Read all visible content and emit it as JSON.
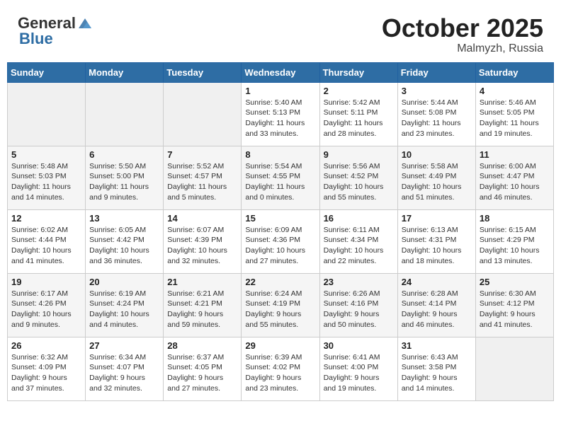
{
  "header": {
    "logo_line1": "General",
    "logo_line2": "Blue",
    "month": "October 2025",
    "location": "Malmyzh, Russia"
  },
  "weekdays": [
    "Sunday",
    "Monday",
    "Tuesday",
    "Wednesday",
    "Thursday",
    "Friday",
    "Saturday"
  ],
  "rows": [
    {
      "bg": "white",
      "cells": [
        {
          "day": "",
          "info": "",
          "empty": true
        },
        {
          "day": "",
          "info": "",
          "empty": true
        },
        {
          "day": "",
          "info": "",
          "empty": true
        },
        {
          "day": "1",
          "info": "Sunrise: 5:40 AM\nSunset: 5:13 PM\nDaylight: 11 hours\nand 33 minutes.",
          "empty": false
        },
        {
          "day": "2",
          "info": "Sunrise: 5:42 AM\nSunset: 5:11 PM\nDaylight: 11 hours\nand 28 minutes.",
          "empty": false
        },
        {
          "day": "3",
          "info": "Sunrise: 5:44 AM\nSunset: 5:08 PM\nDaylight: 11 hours\nand 23 minutes.",
          "empty": false
        },
        {
          "day": "4",
          "info": "Sunrise: 5:46 AM\nSunset: 5:05 PM\nDaylight: 11 hours\nand 19 minutes.",
          "empty": false
        }
      ]
    },
    {
      "bg": "alt",
      "cells": [
        {
          "day": "5",
          "info": "Sunrise: 5:48 AM\nSunset: 5:03 PM\nDaylight: 11 hours\nand 14 minutes.",
          "empty": false
        },
        {
          "day": "6",
          "info": "Sunrise: 5:50 AM\nSunset: 5:00 PM\nDaylight: 11 hours\nand 9 minutes.",
          "empty": false
        },
        {
          "day": "7",
          "info": "Sunrise: 5:52 AM\nSunset: 4:57 PM\nDaylight: 11 hours\nand 5 minutes.",
          "empty": false
        },
        {
          "day": "8",
          "info": "Sunrise: 5:54 AM\nSunset: 4:55 PM\nDaylight: 11 hours\nand 0 minutes.",
          "empty": false
        },
        {
          "day": "9",
          "info": "Sunrise: 5:56 AM\nSunset: 4:52 PM\nDaylight: 10 hours\nand 55 minutes.",
          "empty": false
        },
        {
          "day": "10",
          "info": "Sunrise: 5:58 AM\nSunset: 4:49 PM\nDaylight: 10 hours\nand 51 minutes.",
          "empty": false
        },
        {
          "day": "11",
          "info": "Sunrise: 6:00 AM\nSunset: 4:47 PM\nDaylight: 10 hours\nand 46 minutes.",
          "empty": false
        }
      ]
    },
    {
      "bg": "white",
      "cells": [
        {
          "day": "12",
          "info": "Sunrise: 6:02 AM\nSunset: 4:44 PM\nDaylight: 10 hours\nand 41 minutes.",
          "empty": false
        },
        {
          "day": "13",
          "info": "Sunrise: 6:05 AM\nSunset: 4:42 PM\nDaylight: 10 hours\nand 36 minutes.",
          "empty": false
        },
        {
          "day": "14",
          "info": "Sunrise: 6:07 AM\nSunset: 4:39 PM\nDaylight: 10 hours\nand 32 minutes.",
          "empty": false
        },
        {
          "day": "15",
          "info": "Sunrise: 6:09 AM\nSunset: 4:36 PM\nDaylight: 10 hours\nand 27 minutes.",
          "empty": false
        },
        {
          "day": "16",
          "info": "Sunrise: 6:11 AM\nSunset: 4:34 PM\nDaylight: 10 hours\nand 22 minutes.",
          "empty": false
        },
        {
          "day": "17",
          "info": "Sunrise: 6:13 AM\nSunset: 4:31 PM\nDaylight: 10 hours\nand 18 minutes.",
          "empty": false
        },
        {
          "day": "18",
          "info": "Sunrise: 6:15 AM\nSunset: 4:29 PM\nDaylight: 10 hours\nand 13 minutes.",
          "empty": false
        }
      ]
    },
    {
      "bg": "alt",
      "cells": [
        {
          "day": "19",
          "info": "Sunrise: 6:17 AM\nSunset: 4:26 PM\nDaylight: 10 hours\nand 9 minutes.",
          "empty": false
        },
        {
          "day": "20",
          "info": "Sunrise: 6:19 AM\nSunset: 4:24 PM\nDaylight: 10 hours\nand 4 minutes.",
          "empty": false
        },
        {
          "day": "21",
          "info": "Sunrise: 6:21 AM\nSunset: 4:21 PM\nDaylight: 9 hours\nand 59 minutes.",
          "empty": false
        },
        {
          "day": "22",
          "info": "Sunrise: 6:24 AM\nSunset: 4:19 PM\nDaylight: 9 hours\nand 55 minutes.",
          "empty": false
        },
        {
          "day": "23",
          "info": "Sunrise: 6:26 AM\nSunset: 4:16 PM\nDaylight: 9 hours\nand 50 minutes.",
          "empty": false
        },
        {
          "day": "24",
          "info": "Sunrise: 6:28 AM\nSunset: 4:14 PM\nDaylight: 9 hours\nand 46 minutes.",
          "empty": false
        },
        {
          "day": "25",
          "info": "Sunrise: 6:30 AM\nSunset: 4:12 PM\nDaylight: 9 hours\nand 41 minutes.",
          "empty": false
        }
      ]
    },
    {
      "bg": "white",
      "cells": [
        {
          "day": "26",
          "info": "Sunrise: 6:32 AM\nSunset: 4:09 PM\nDaylight: 9 hours\nand 37 minutes.",
          "empty": false
        },
        {
          "day": "27",
          "info": "Sunrise: 6:34 AM\nSunset: 4:07 PM\nDaylight: 9 hours\nand 32 minutes.",
          "empty": false
        },
        {
          "day": "28",
          "info": "Sunrise: 6:37 AM\nSunset: 4:05 PM\nDaylight: 9 hours\nand 27 minutes.",
          "empty": false
        },
        {
          "day": "29",
          "info": "Sunrise: 6:39 AM\nSunset: 4:02 PM\nDaylight: 9 hours\nand 23 minutes.",
          "empty": false
        },
        {
          "day": "30",
          "info": "Sunrise: 6:41 AM\nSunset: 4:00 PM\nDaylight: 9 hours\nand 19 minutes.",
          "empty": false
        },
        {
          "day": "31",
          "info": "Sunrise: 6:43 AM\nSunset: 3:58 PM\nDaylight: 9 hours\nand 14 minutes.",
          "empty": false
        },
        {
          "day": "",
          "info": "",
          "empty": true
        }
      ]
    }
  ]
}
